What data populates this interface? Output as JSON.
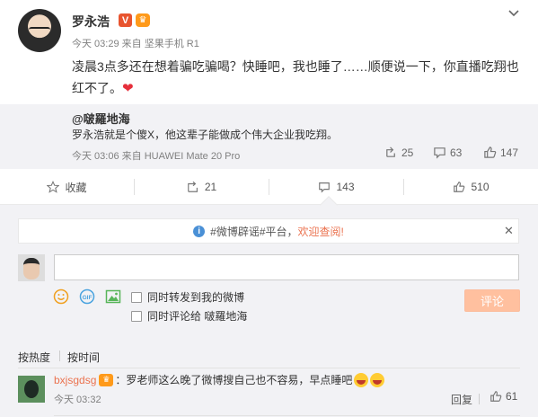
{
  "post": {
    "author": "罗永浩",
    "verified_badge": "V",
    "member_badge": "会员",
    "meta": "今天 03:29 来自 坚果手机 R1",
    "text": "凌晨3点多还在想着骗吃骗喝？快睡吧，我也睡了……顺便说一下，你直播吃翔也红不了。"
  },
  "repost": {
    "author": "@啵羅地海",
    "text": "罗永浩就是个傻X，他这辈子能做成个伟大企业我吃翔。",
    "meta": "今天 03:06 来自 HUAWEI Mate 20 Pro",
    "reposts": "25",
    "comments": "63",
    "likes": "147"
  },
  "actions": {
    "favorite": "收藏",
    "forward": "21",
    "comment": "143",
    "like": "510"
  },
  "notice": {
    "text": "#微博辟谣#平台，",
    "link": "欢迎查阅!"
  },
  "composer": {
    "placeholder": "",
    "also_forward": "同时转发到我的微博",
    "also_comment": "同时评论给 啵羅地海",
    "submit": "评论"
  },
  "sort": {
    "hot": "按热度",
    "time": "按时间"
  },
  "comment": {
    "user": "bxjsgdsg",
    "text": "：罗老师这么晚了微博搜自己也不容易，早点睡吧",
    "meta": "今天 03:32",
    "reply": "回复",
    "likes": "61"
  },
  "colors": {
    "accent": "#eb7350",
    "submit_disabled": "#ffc09f",
    "panel": "#f2f2f5"
  },
  "icons": [
    "dropdown-chevron-icon",
    "verified-icon",
    "vip-icon",
    "heart-icon",
    "forward-icon",
    "comment-icon",
    "like-icon",
    "star-icon",
    "info-icon",
    "close-icon",
    "emoticon-icon",
    "gif-icon",
    "image-icon"
  ]
}
